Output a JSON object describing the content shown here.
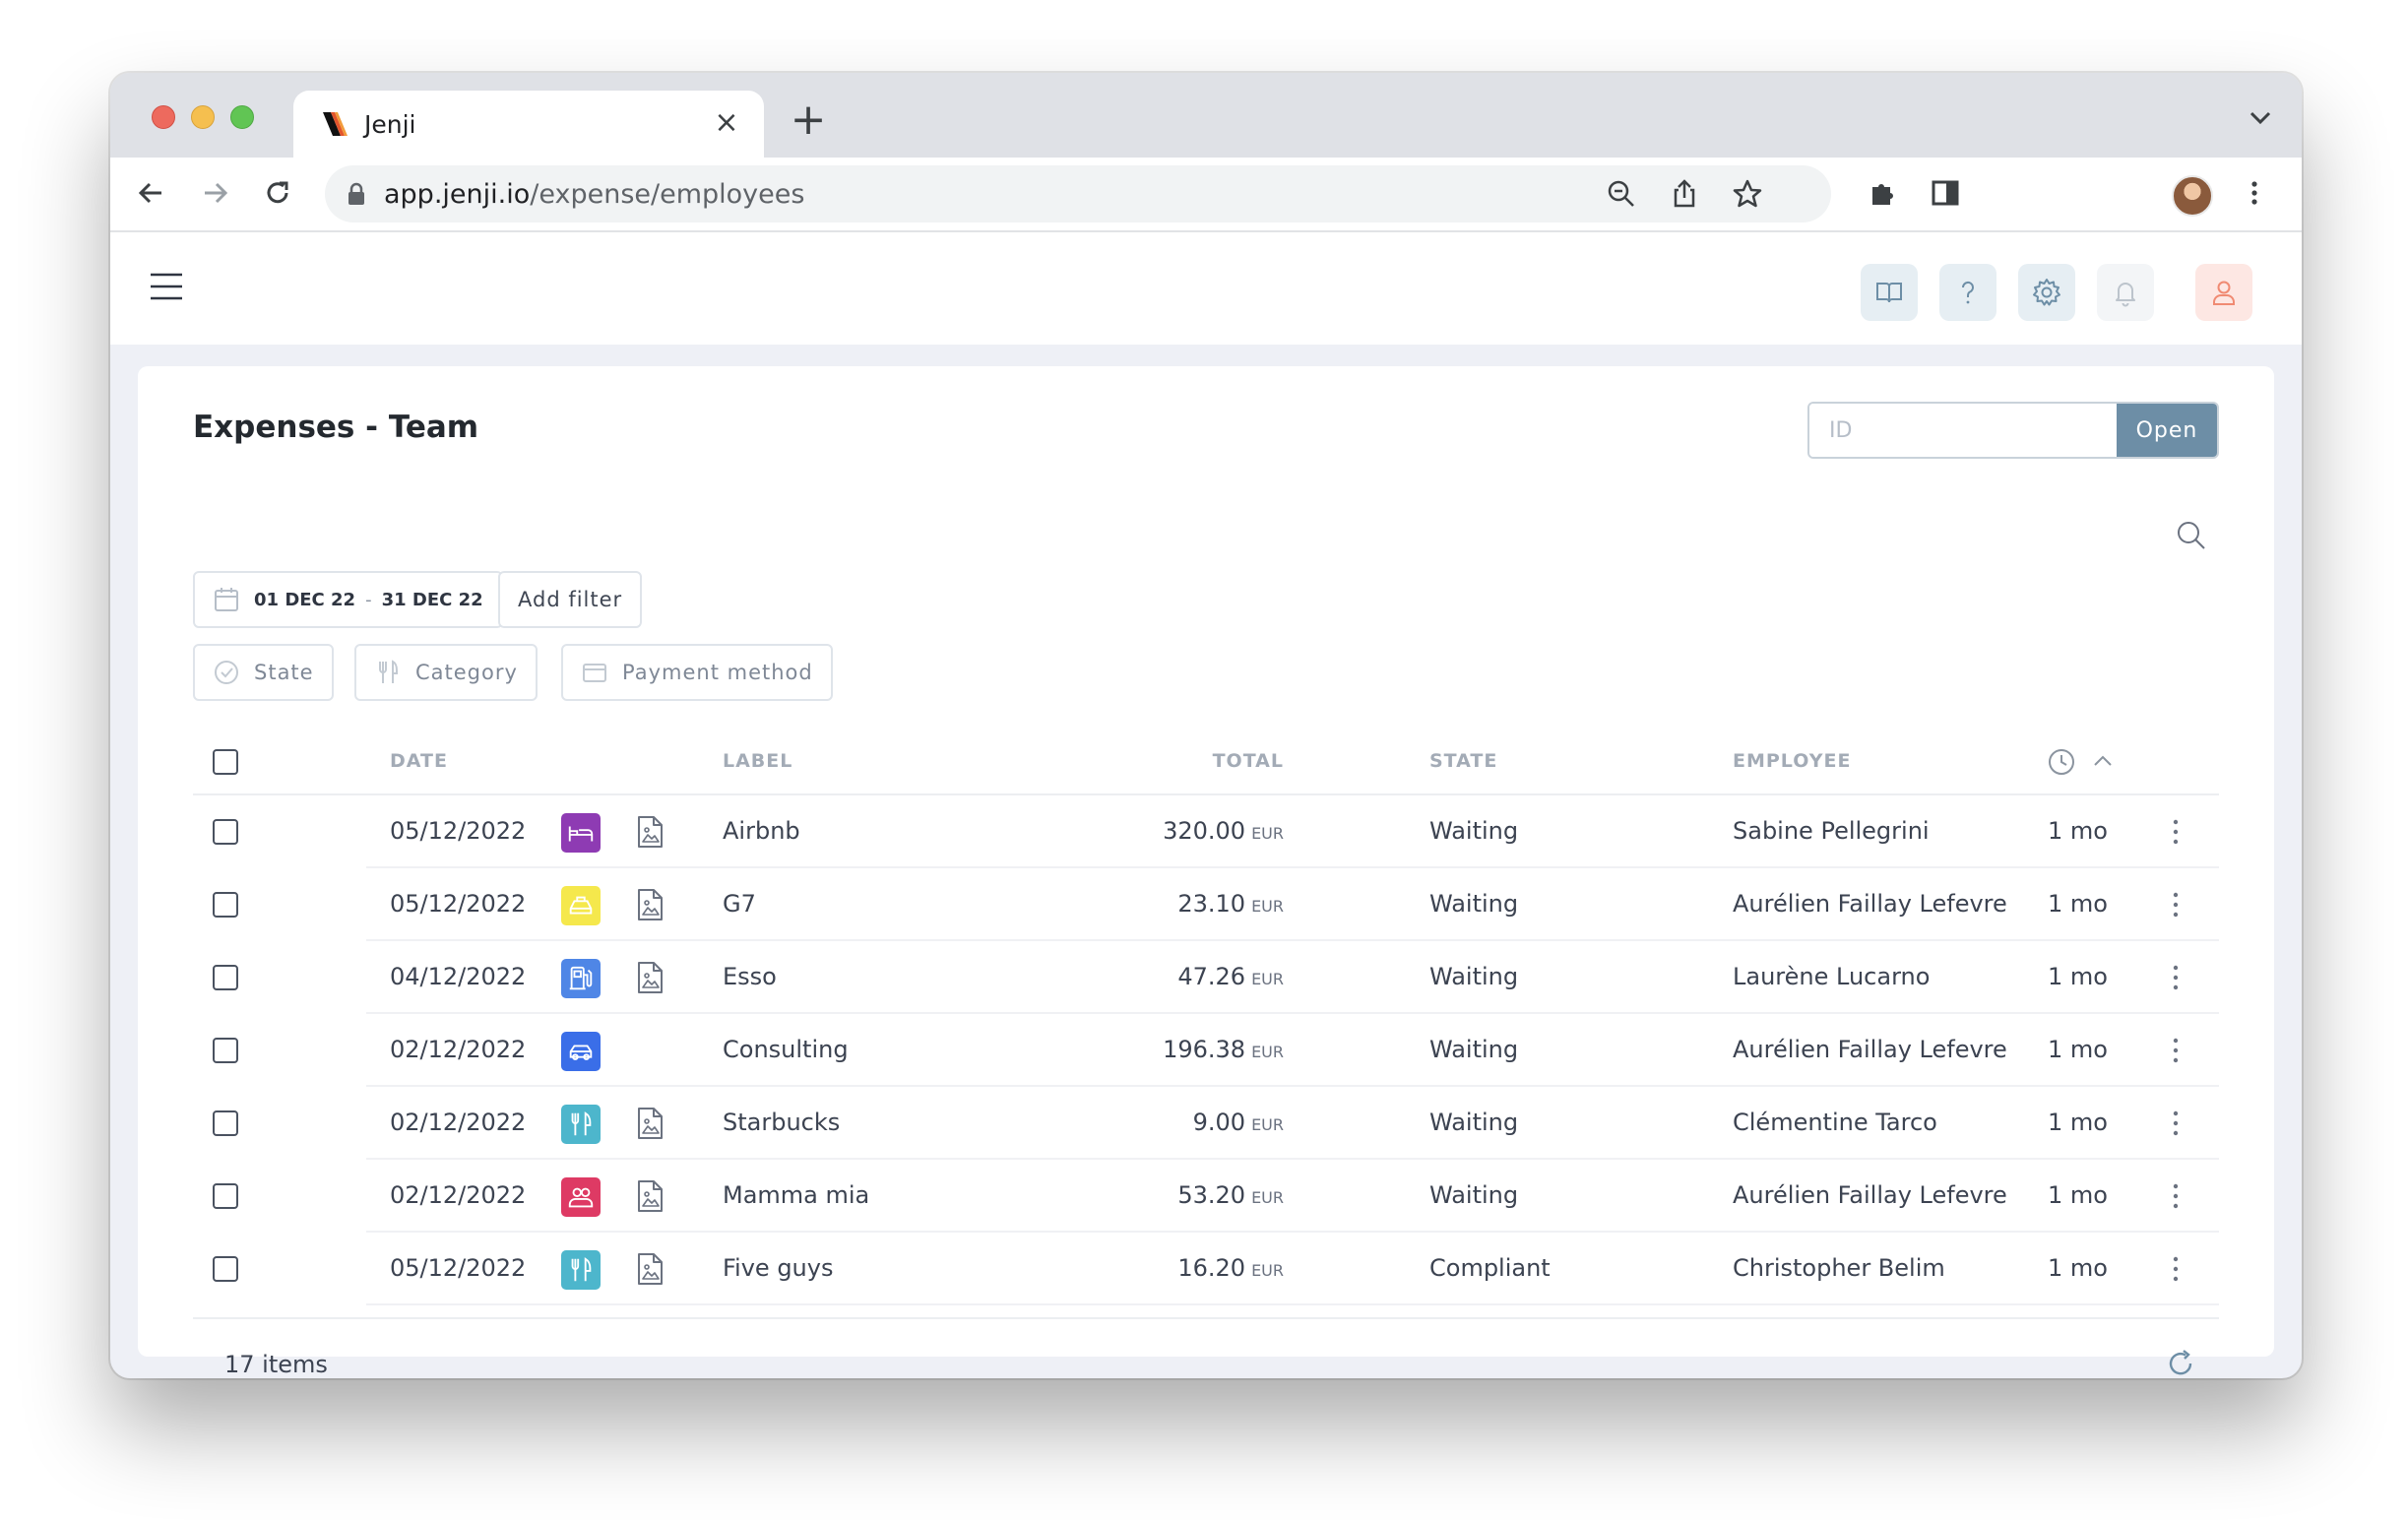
{
  "browser": {
    "tab_title": "Jenji",
    "url_host": "app.jenji.io",
    "url_path": "/expense/employees"
  },
  "page": {
    "title": "Expenses - Team",
    "id_placeholder": "ID",
    "open_label": "Open"
  },
  "filters": {
    "date_from": "01 DEC 22",
    "date_sep": "-",
    "date_to": "31 DEC 22",
    "add_filter": "Add filter",
    "state": "State",
    "category": "Category",
    "payment_method": "Payment method"
  },
  "table": {
    "headers": {
      "date": "DATE",
      "label": "LABEL",
      "total": "TOTAL",
      "state": "STATE",
      "employee": "EMPLOYEE"
    },
    "rows": [
      {
        "date": "05/12/2022",
        "category_icon": "bed-icon",
        "category_color": "#8e3bb3",
        "has_receipt": true,
        "label": "Airbnb",
        "total": "320.00",
        "currency": "EUR",
        "state": "Waiting",
        "employee": "Sabine Pellegrini",
        "age": "1 mo"
      },
      {
        "date": "05/12/2022",
        "category_icon": "taxi-icon",
        "category_color": "#f5e84c",
        "has_receipt": true,
        "label": "G7",
        "total": "23.10",
        "currency": "EUR",
        "state": "Waiting",
        "employee": "Aurélien Faillay Lefevre",
        "age": "1 mo"
      },
      {
        "date": "04/12/2022",
        "category_icon": "fuel-icon",
        "category_color": "#4f86e6",
        "has_receipt": true,
        "label": "Esso",
        "total": "47.26",
        "currency": "EUR",
        "state": "Waiting",
        "employee": "Laurène Lucarno",
        "age": "1 mo"
      },
      {
        "date": "02/12/2022",
        "category_icon": "car-icon",
        "category_color": "#3a6ee8",
        "has_receipt": false,
        "label": "Consulting",
        "total": "196.38",
        "currency": "EUR",
        "state": "Waiting",
        "employee": "Aurélien Faillay Lefevre",
        "age": "1 mo"
      },
      {
        "date": "02/12/2022",
        "category_icon": "utensils-icon",
        "category_color": "#4db6cc",
        "has_receipt": true,
        "label": "Starbucks",
        "total": "9.00",
        "currency": "EUR",
        "state": "Waiting",
        "employee": "Clémentine Tarco",
        "age": "1 mo"
      },
      {
        "date": "02/12/2022",
        "category_icon": "guests-icon",
        "category_color": "#de3a64",
        "has_receipt": true,
        "label": "Mamma mia",
        "total": "53.20",
        "currency": "EUR",
        "state": "Waiting",
        "employee": "Aurélien Faillay Lefevre",
        "age": "1 mo"
      },
      {
        "date": "05/12/2022",
        "category_icon": "utensils-icon",
        "category_color": "#4db6cc",
        "has_receipt": true,
        "label": "Five guys",
        "total": "16.20",
        "currency": "EUR",
        "state": "Compliant",
        "employee": "Christopher Belim",
        "age": "1 mo"
      }
    ]
  },
  "footer": {
    "items_count": "17 items"
  },
  "colors": {
    "accent": "#6d8ea6",
    "user_icon": "#f08a72",
    "header_btn_bg": "#e6eef3"
  }
}
